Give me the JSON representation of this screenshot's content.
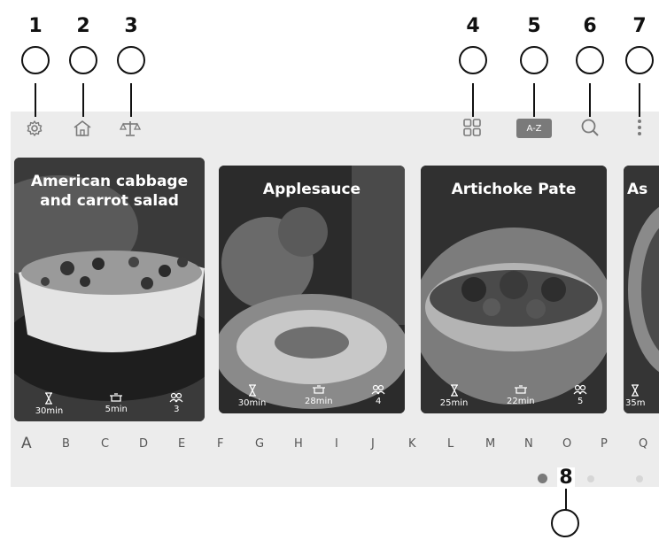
{
  "callouts": [
    "1",
    "2",
    "3",
    "4",
    "5",
    "6",
    "7",
    "8"
  ],
  "toolbar": {
    "sort_label": "A-Z"
  },
  "recipes": [
    {
      "title": "American cabbage and carrot salad",
      "prep_time": "30min",
      "cook_time": "5min",
      "servings": "3"
    },
    {
      "title": "Applesauce",
      "prep_time": "30min",
      "cook_time": "28min",
      "servings": "4"
    },
    {
      "title": "Artichoke Pate",
      "prep_time": "25min",
      "cook_time": "22min",
      "servings": "5"
    },
    {
      "title": "As",
      "prep_time": "35m"
    }
  ],
  "alphabet": [
    "A",
    "B",
    "C",
    "D",
    "E",
    "F",
    "G",
    "H",
    "I",
    "J",
    "K",
    "L",
    "M",
    "N",
    "O",
    "P",
    "Q"
  ],
  "pagination": {
    "pages": 3,
    "current": 1
  },
  "icons": {
    "settings": "gear-icon",
    "home": "home-icon",
    "scale": "scale-icon",
    "grid": "grid-view-icon",
    "search": "search-icon",
    "more": "more-vertical-icon",
    "prep": "hourglass-icon",
    "cook": "pot-icon",
    "servings": "people-icon"
  },
  "colors": {
    "panel": "#ececec",
    "icon": "#7a7a7a",
    "sort_badge": "#7a7a7a",
    "dot_active": "#7a7a7a",
    "dot_inactive": "#d6d6d6"
  }
}
